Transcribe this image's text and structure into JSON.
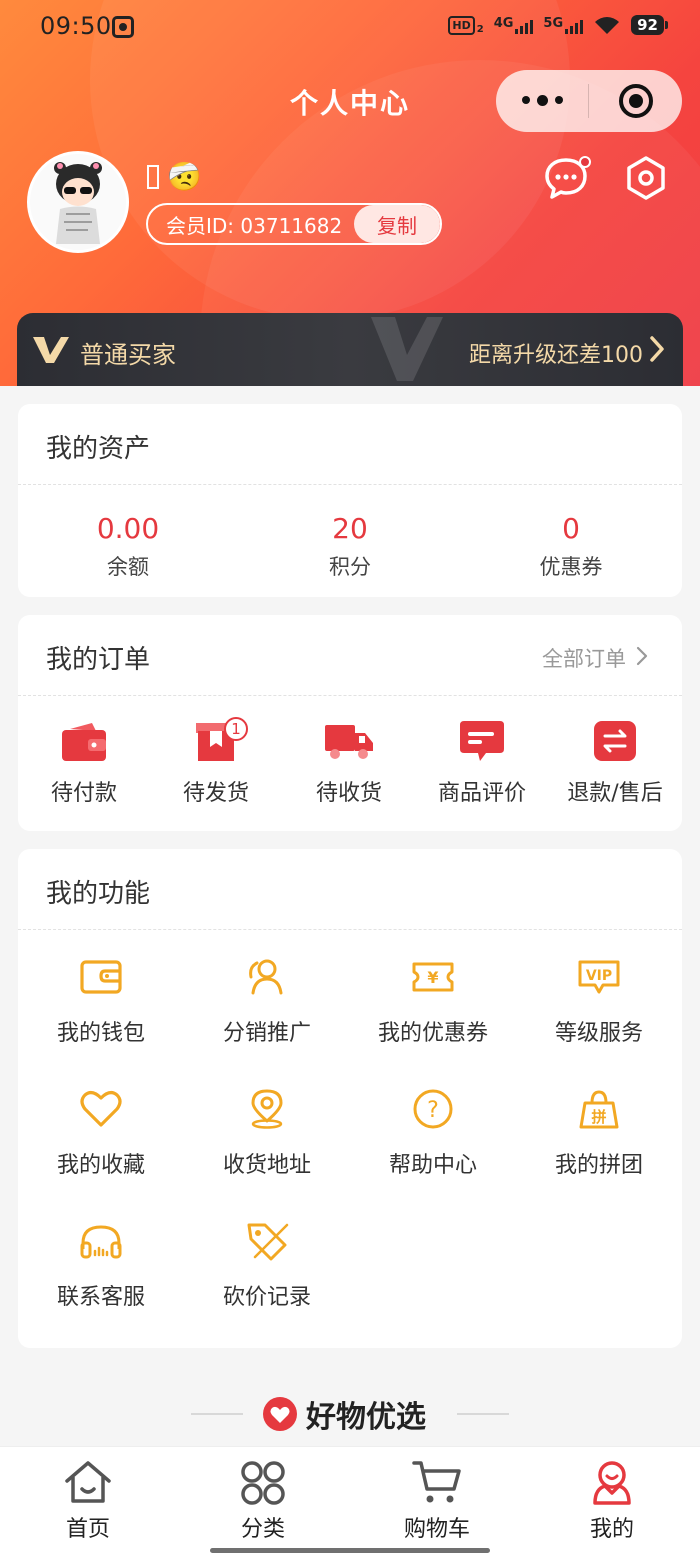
{
  "status_bar": {
    "time": "09:50",
    "hd": "HD",
    "hd_sub": "2",
    "net1": "4G",
    "net2": "5G",
    "battery": "92"
  },
  "nav": {
    "title": "个人中心"
  },
  "profile": {
    "nickname_emoji": "🤕",
    "member_id": "会员ID: 03711682",
    "copy_label": "复制"
  },
  "vip": {
    "level": "普通买家",
    "upgrade": "距离升级还差100"
  },
  "assets": {
    "title": "我的资产",
    "items": [
      {
        "value": "0.00",
        "label": "余额"
      },
      {
        "value": "20",
        "label": "积分"
      },
      {
        "value": "0",
        "label": "优惠券"
      }
    ]
  },
  "orders": {
    "title": "我的订单",
    "all_label": "全部订单",
    "items": [
      {
        "label": "待付款",
        "icon": "wallet-icon"
      },
      {
        "label": "待发货",
        "icon": "package-icon",
        "badge": "1"
      },
      {
        "label": "待收货",
        "icon": "truck-icon"
      },
      {
        "label": "商品评价",
        "icon": "comment-icon"
      },
      {
        "label": "退款/售后",
        "icon": "refund-icon"
      }
    ]
  },
  "functions": {
    "title": "我的功能",
    "items": [
      {
        "label": "我的钱包",
        "icon": "wallet-icon"
      },
      {
        "label": "分销推广",
        "icon": "users-icon"
      },
      {
        "label": "我的优惠券",
        "icon": "coupon-icon"
      },
      {
        "label": "等级服务",
        "icon": "vip-icon"
      },
      {
        "label": "我的收藏",
        "icon": "heart-icon"
      },
      {
        "label": "收货地址",
        "icon": "location-icon"
      },
      {
        "label": "帮助中心",
        "icon": "help-icon"
      },
      {
        "label": "我的拼团",
        "icon": "group-buy-icon"
      },
      {
        "label": "联系客服",
        "icon": "headset-icon"
      },
      {
        "label": "砍价记录",
        "icon": "bargain-icon"
      }
    ],
    "coupon_symbol": "¥",
    "vip_text": "VIP",
    "help_symbol": "?",
    "group_symbol": "拼"
  },
  "recommend": {
    "title": "好物优选"
  },
  "tabbar": {
    "items": [
      {
        "label": "首页",
        "icon": "home-icon"
      },
      {
        "label": "分类",
        "icon": "category-icon"
      },
      {
        "label": "购物车",
        "icon": "cart-icon"
      },
      {
        "label": "我的",
        "icon": "user-icon"
      }
    ],
    "active": "我的"
  },
  "colors": {
    "accent": "#e5393f",
    "gold": "#f2a823",
    "header_start": "#ff8a3d",
    "header_end": "#ef3c45",
    "vip_text": "#f4d9a8"
  }
}
